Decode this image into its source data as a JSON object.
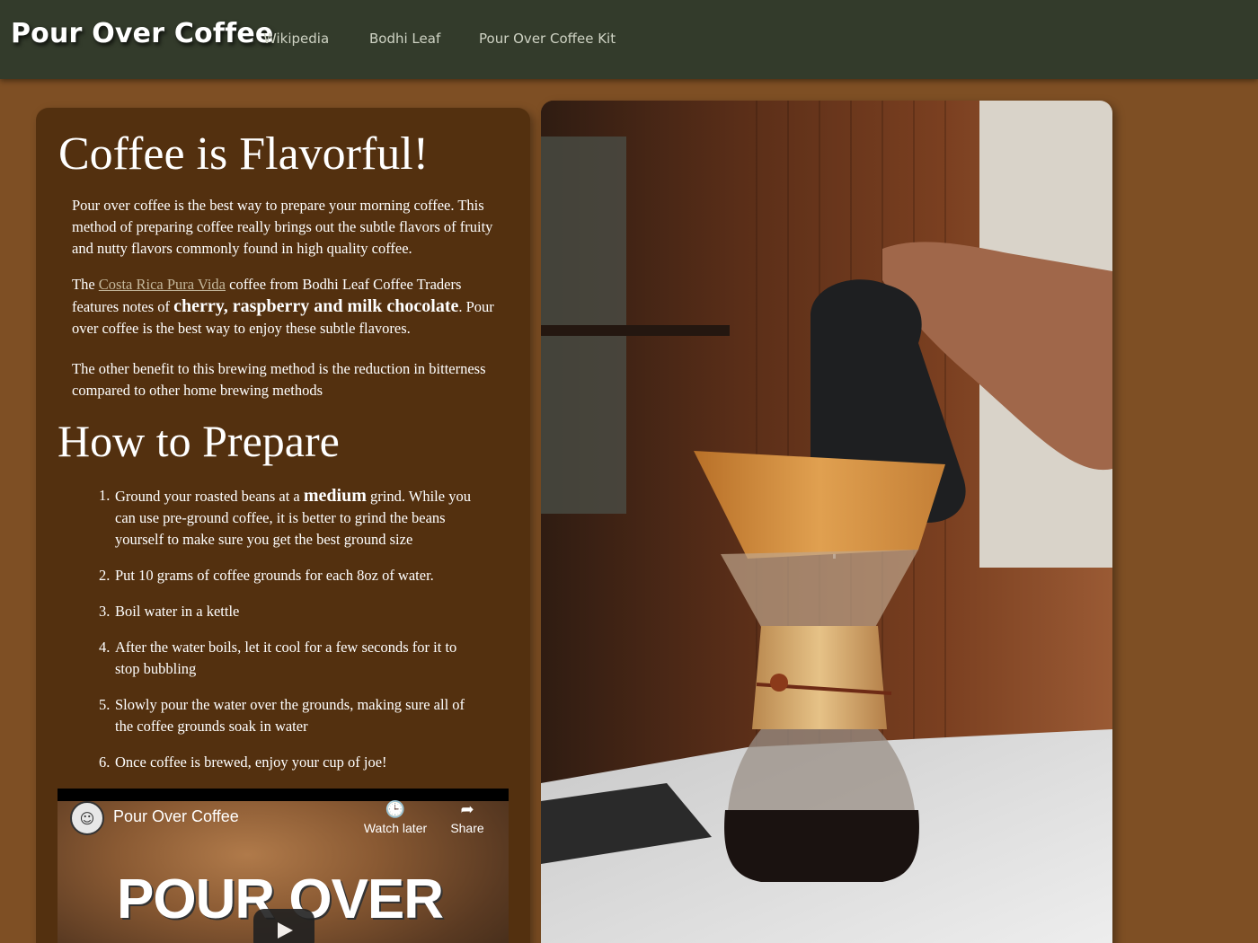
{
  "header": {
    "brand": "Pour Over Coffee",
    "nav": [
      "Wikipedia",
      "Bodhi Leaf",
      "Pour Over Coffee Kit"
    ]
  },
  "intro": {
    "heading": "Coffee is Flavorful!",
    "p1": "Pour over coffee is the best way to prepare your morning coffee. This method of preparing coffee really brings out the subtle flavors of fruity and nutty flavors commonly found in high quality coffee.",
    "p2_before_link": "The ",
    "p2_link": "Costa Rica Pura Vida",
    "p2_after_link": " coffee from Bodhi Leaf Coffee Traders features notes of ",
    "p2_emphasis": "cherry, raspberry and milk chocolate",
    "p2_end": ". Pour over coffee is the best way to enjoy these subtle flavores.",
    "p3": "The other benefit to this brewing method is the reduction in bitterness compared to other home brewing methods"
  },
  "prepare": {
    "heading": "How to Prepare",
    "step1_before": "Ground your roasted beans at a ",
    "step1_emphasis": "medium",
    "step1_after": " grind. While you can use pre-ground coffee, it is better to grind the beans yourself to make sure you get the best ground size",
    "steps": [
      "Put 10 grams of coffee grounds for each 8oz of water.",
      "Boil water in a kettle",
      "After the water boils, let it cool for a few seconds for it to stop bubbling",
      "Slowly pour the water over the grounds, making sure all of the coffee grounds soak in water",
      "Once coffee is brewed, enjoy your cup of joe!"
    ],
    "numbers": [
      "1.",
      "2.",
      "3.",
      "4.",
      "5.",
      "6."
    ]
  },
  "video": {
    "title": "Pour Over Coffee",
    "watch_later": "Watch later",
    "share": "Share",
    "thumbnail_text": "POUR OVER",
    "icons": {
      "watch_later": "clock-icon",
      "share": "share-icon",
      "play": "play-icon"
    }
  },
  "photo": {
    "subject": "pour-over-coffee-photo"
  }
}
